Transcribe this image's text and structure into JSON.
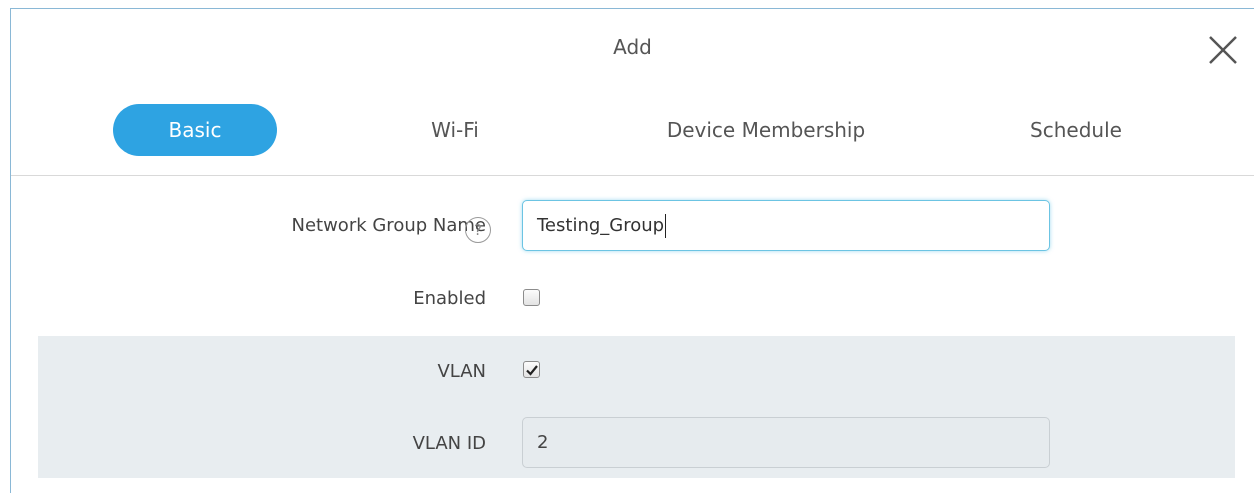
{
  "dialog": {
    "title": "Add",
    "close_icon": "close-icon"
  },
  "tabs": [
    {
      "label": "Basic",
      "active": true
    },
    {
      "label": "Wi-Fi",
      "active": false
    },
    {
      "label": "Device Membership",
      "active": false
    },
    {
      "label": "Schedule",
      "active": false
    }
  ],
  "form": {
    "network_group_name": {
      "label": "Network Group Name",
      "help_icon": "question-mark-icon",
      "help_glyph": "?",
      "value": "Testing_Group"
    },
    "enabled": {
      "label": "Enabled",
      "checked": false
    },
    "vlan": {
      "label": "VLAN",
      "checked": true
    },
    "vlan_id": {
      "label": "VLAN ID",
      "value": "2"
    }
  },
  "colors": {
    "accent": "#2ea3e2",
    "dialog_border": "#8ab8d6",
    "shaded_section": "#e8edf0"
  }
}
